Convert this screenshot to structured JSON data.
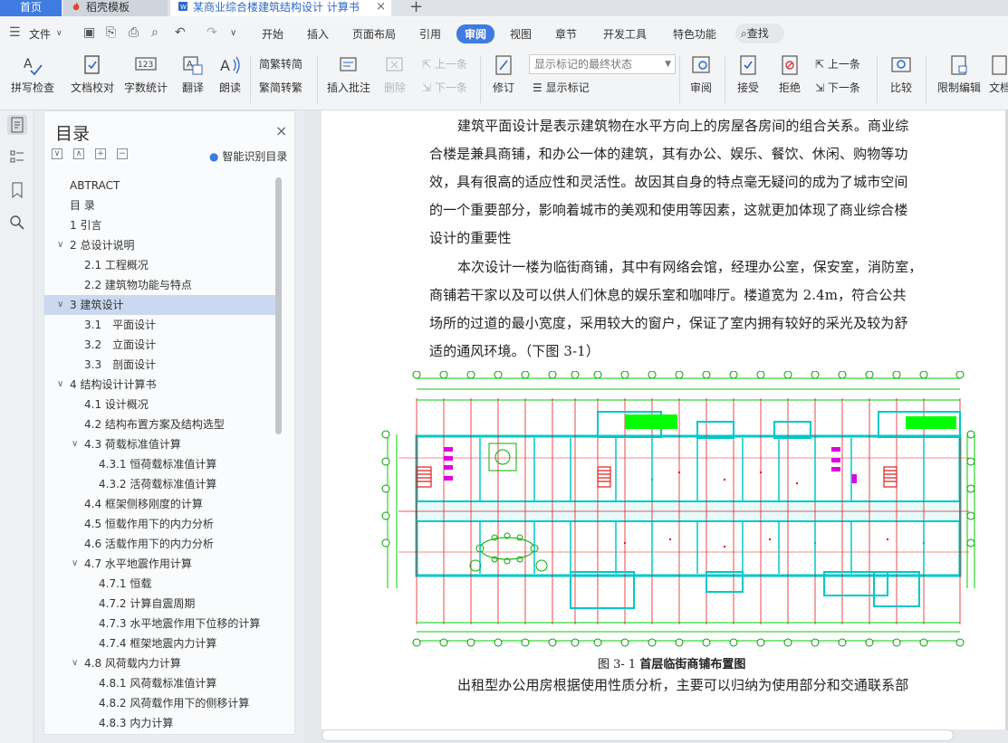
{
  "tabs": {
    "home": "首页",
    "template": "稻壳模板",
    "document": "某商业综合楼建筑结构设计 计算书"
  },
  "menu": {
    "file": "文件",
    "items": [
      "开始",
      "插入",
      "页面布局",
      "引用",
      "审阅",
      "视图",
      "章节",
      "开发工具",
      "特色功能"
    ],
    "active": "审阅",
    "search": "查找"
  },
  "ribbon": {
    "spellcheck": "拼写检查",
    "doc_proof": "文档校对",
    "word_count": "字数统计",
    "translate": "翻译",
    "read_aloud": "朗读",
    "to_traditional": "繁转简",
    "to_simplified": "简转繁",
    "insert_comment": "插入批注",
    "delete": "删除",
    "prev": "上一条",
    "next": "下一条",
    "revise": "修订",
    "markup_state": "显示标记的最终状态",
    "show_markup": "显示标记",
    "review": "审阅",
    "accept": "接受",
    "reject": "拒绝",
    "prev2": "上一条",
    "next2": "下一条",
    "compare": "比较",
    "restrict": "限制编辑",
    "doc_perm": "文档"
  },
  "toc": {
    "title": "目录",
    "smart": "智能识别目录",
    "items": [
      {
        "label": "ABTRACT",
        "level": 1
      },
      {
        "label": "目 录",
        "level": 1
      },
      {
        "label": "1 引言",
        "level": 1
      },
      {
        "label": "2 总设计说明",
        "level": 1,
        "expanded": true
      },
      {
        "label": "2.1 工程概况",
        "level": 2
      },
      {
        "label": "2.2 建筑物功能与特点",
        "level": 2
      },
      {
        "label": "3 建筑设计",
        "level": 1,
        "expanded": true,
        "selected": true
      },
      {
        "label": "3.1　平面设计",
        "level": 2
      },
      {
        "label": "3.2　立面设计",
        "level": 2
      },
      {
        "label": "3.3　剖面设计",
        "level": 2
      },
      {
        "label": "4 结构设计计算书",
        "level": 1,
        "expanded": true
      },
      {
        "label": "4.1 设计概况",
        "level": 2
      },
      {
        "label": "4.2 结构布置方案及结构选型",
        "level": 2
      },
      {
        "label": "4.3 荷载标准值计算",
        "level": 2,
        "expanded": true
      },
      {
        "label": "4.3.1 恒荷载标准值计算",
        "level": 3
      },
      {
        "label": "4.3.2 活荷载标准值计算",
        "level": 3
      },
      {
        "label": "4.4 框架侧移刚度的计算",
        "level": 2
      },
      {
        "label": "4.5 恒载作用下的内力分析",
        "level": 2
      },
      {
        "label": "4.6 活载作用下的内力分析",
        "level": 2
      },
      {
        "label": "4.7 水平地震作用计算",
        "level": 2,
        "expanded": true
      },
      {
        "label": "4.7.1 恒载",
        "level": 3
      },
      {
        "label": "4.7.2 计算自震周期",
        "level": 3
      },
      {
        "label": "4.7.3 水平地震作用下位移的计算",
        "level": 3
      },
      {
        "label": "4.7.4 框架地震内力计算",
        "level": 3
      },
      {
        "label": "4.8 风荷载内力计算",
        "level": 2,
        "expanded": true
      },
      {
        "label": "4.8.1 风荷载标准值计算",
        "level": 3
      },
      {
        "label": "4.8.2 风荷载作用下的侧移计算",
        "level": 3
      },
      {
        "label": "4.8.3 内力计算",
        "level": 3
      }
    ]
  },
  "document": {
    "p1": [
      "建筑平面设计是表示建筑物在水平方向上的房屋各房间的组合关系。商业综",
      "合楼是兼具商铺，和办公一体的建筑，其有办公、娱乐、餐饮、休闲、购物等功",
      "效，具有很高的适应性和灵活性。故因其自身的特点毫无疑问的成为了城市空间",
      "的一个重要部分，影响着城市的美观和使用等因素，这就更加体现了商业综合楼",
      "设计的重要性"
    ],
    "p2": [
      "本次设计一楼为临街商铺，其中有网络会馆，经理办公室，保安室，消防室，",
      "商铺若干家以及可以供人们休息的娱乐室和咖啡厅。楼道宽为 2.4m，符合公共",
      "场所的过道的最小宽度，采用较大的窗户，保证了室内拥有较好的采光及较为舒",
      "适的通风环境。（下图 3-1）"
    ],
    "caption_num": "图 3- 1",
    "caption_text": "首层临街商铺布置图",
    "p3": "出租型办公用房根据使用性质分析，主要可以归纳为使用部分和交通联系部"
  }
}
